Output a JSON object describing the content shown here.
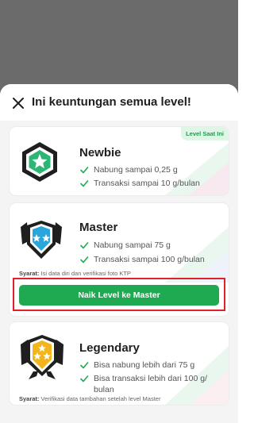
{
  "sheet": {
    "title": "Ini keuntungan semua level!"
  },
  "levels": [
    {
      "name": "Newbie",
      "current_badge": "Level Saat Ini",
      "benefits": [
        "Nabung sampai 0,25 g",
        "Transaksi sampai 10 g/bulan"
      ]
    },
    {
      "name": "Master",
      "benefits": [
        "Nabung sampai 75 g",
        "Transaksi sampai 100 g/bulan"
      ],
      "syarat_label": "Syarat:",
      "syarat_text": "Isi data diri dan verifikasi foto KTP",
      "cta_label": "Naik Level ke Master"
    },
    {
      "name": "Legendary",
      "benefits": [
        "Bisa nabung lebih dari 75 g",
        "Bisa transaksi lebih dari 100 g/",
        "bulan"
      ],
      "syarat_label": "Syarat:",
      "syarat_text": "Verifikasi data tambahan setelah level Master"
    }
  ],
  "colors": {
    "brand_green": "#1faa52",
    "highlight_red": "#e0202a",
    "overlay": "#6b6b6b",
    "newbie_badge": "#2bb673",
    "master_badge": "#2aa6dc",
    "legendary_badge": "#f2b51c"
  },
  "icons": {
    "close": "close-icon",
    "check": "check-icon"
  }
}
